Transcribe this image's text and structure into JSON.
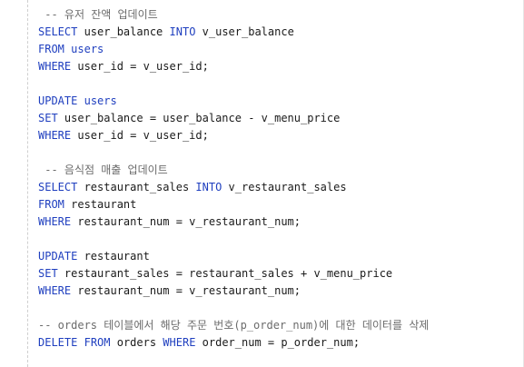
{
  "colors": {
    "keyword": "#1f3fbf",
    "comment": "#6b6b6b",
    "text": "#1a1a1a",
    "background": "#ffffff"
  },
  "code": {
    "lines": [
      {
        "indent": " ",
        "comment": "-- 유저 잔액 업데이트"
      },
      {
        "kw1": "SELECT",
        "tx1": " user_balance ",
        "kw2": "INTO",
        "tx2": " v_user_balance"
      },
      {
        "kw1": "FROM",
        "tx1": " ",
        "kw2": "users"
      },
      {
        "kw1": "WHERE",
        "tx1": " user_id = v_user_id;"
      },
      {},
      {
        "kw1": "UPDATE",
        "tx1": " ",
        "kw2": "users"
      },
      {
        "kw1": "SET",
        "tx1": " user_balance = user_balance - v_menu_price"
      },
      {
        "kw1": "WHERE",
        "tx1": " user_id = v_user_id;"
      },
      {},
      {
        "indent": " ",
        "comment": "-- 음식점 매출 업데이트"
      },
      {
        "kw1": "SELECT",
        "tx1": " restaurant_sales ",
        "kw2": "INTO",
        "tx2": " v_restaurant_sales"
      },
      {
        "kw1": "FROM",
        "tx1": " restaurant"
      },
      {
        "kw1": "WHERE",
        "tx1": " restaurant_num = v_restaurant_num;"
      },
      {},
      {
        "kw1": "UPDATE",
        "tx1": " restaurant"
      },
      {
        "kw1": "SET",
        "tx1": " restaurant_sales = restaurant_sales + v_menu_price"
      },
      {
        "kw1": "WHERE",
        "tx1": " restaurant_num = v_restaurant_num;"
      },
      {},
      {
        "comment": "-- orders 테이블에서 해당 주문 번호(p_order_num)에 대한 데이터를 삭제"
      },
      {
        "kw1": "DELETE",
        "tx1": " ",
        "kw2": "FROM",
        "tx2": " orders ",
        "kw3": "WHERE",
        "tx3": " order_num = p_order_num;"
      }
    ]
  }
}
